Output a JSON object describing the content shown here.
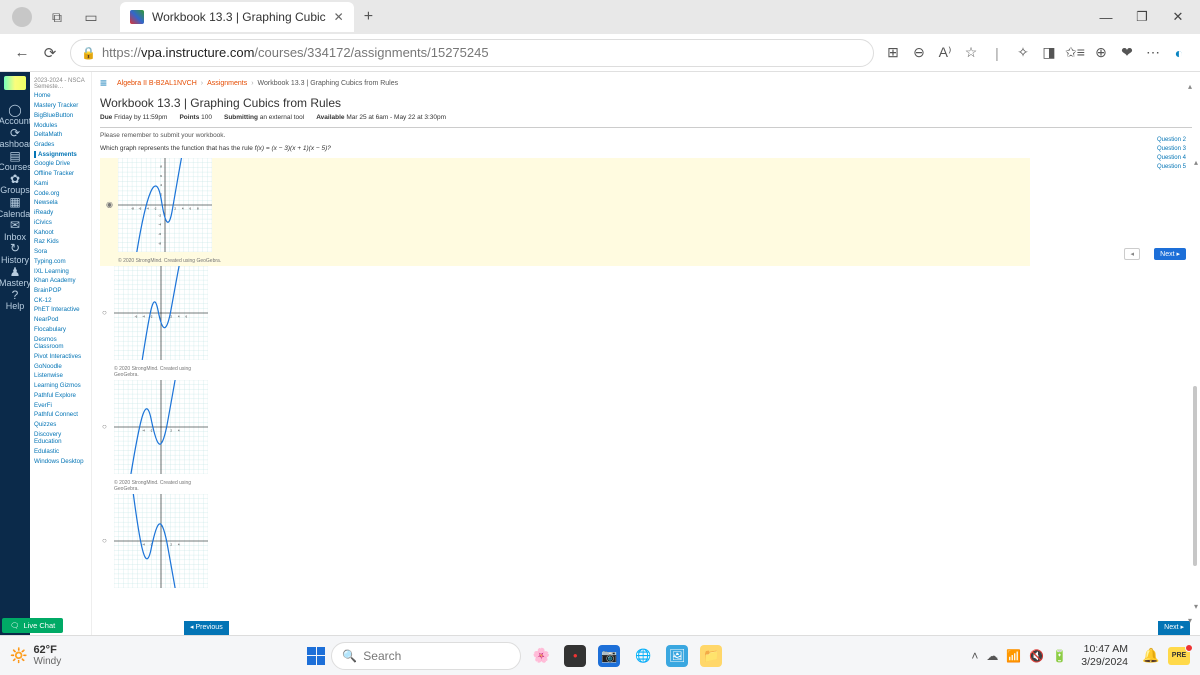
{
  "browser": {
    "tab_title": "Workbook 13.3 | Graphing Cubic",
    "url_host": "vpa.instructure.com",
    "url_path": "/courses/334172/assignments/15275245",
    "url_display_prefix": "https://"
  },
  "global_rail": [
    {
      "icon": "◯",
      "label": "Account"
    },
    {
      "icon": "⟳",
      "label": "Dashboard"
    },
    {
      "icon": "▤",
      "label": "Courses"
    },
    {
      "icon": "✿",
      "label": "Groups"
    },
    {
      "icon": "▦",
      "label": "Calendar"
    },
    {
      "icon": "✉",
      "label": "Inbox"
    },
    {
      "icon": "↻",
      "label": "History"
    },
    {
      "icon": "♟",
      "label": "Mastery"
    },
    {
      "icon": "?",
      "label": "Help"
    }
  ],
  "course_nav": {
    "term": "2023-2024 - NSCA Semeste…",
    "items": [
      "Home",
      "Mastery Tracker",
      "BigBlueButton",
      "Modules",
      "DeltaMath",
      "Grades",
      "Assignments",
      "Google Drive",
      "Offline Tracker",
      "Kami",
      "Code.org",
      "Newsela",
      "iReady",
      "iCivics",
      "Kahoot",
      "Raz Kids",
      "Sora",
      "Typing.com",
      "IXL Learning",
      "Khan Academy",
      "BrainPOP",
      "CK-12",
      "PhET Interactive",
      "NearPod",
      "Flocabulary",
      "Desmos Classroom",
      "Pivot Interactives",
      "GoNoodle",
      "Listenwise",
      "Learning Gizmos",
      "Pathful Explore",
      "EverFi",
      "Pathful Connect",
      "Quizzes",
      "Discovery Education",
      "Edulastic",
      "Windows Desktop"
    ],
    "selected": "Assignments"
  },
  "breadcrumbs": [
    "Algebra II B-B2AL1NVCH",
    "Assignments",
    "Workbook 13.3 | Graphing Cubics from Rules"
  ],
  "page_title": "Workbook 13.3 | Graphing Cubics from Rules",
  "meta": {
    "due_label": "Due",
    "due_value": "Friday by 11:59pm",
    "points_label": "Points",
    "points_value": "100",
    "submitting_label": "Submitting",
    "submitting_value": "an external tool",
    "available_label": "Available",
    "available_value": "Mar 25 at 6am - May 22 at 3:30pm"
  },
  "tool": {
    "instruction": "Please remember to submit your workbook.",
    "question_text_pre": "Which graph represents the function that has the rule ",
    "question_rule": "f(x) = (x − 3)(x + 1)(x − 5)?",
    "caption": "© 2020 StrongMind. Created using GeoGebra.",
    "next_label": "Next ▸",
    "prev_ghost": "◂",
    "qpanel": [
      "Question 2",
      "Question 3",
      "Question 4",
      "Question 5"
    ],
    "bottom_prev": "◂ Previous",
    "bottom_next": "Next ▸"
  },
  "live_chat": "Live Chat",
  "taskbar": {
    "temp": "62°F",
    "cond": "Windy",
    "search": "Search",
    "time": "10:47 AM",
    "date": "3/29/2024",
    "pre": "PRE"
  }
}
